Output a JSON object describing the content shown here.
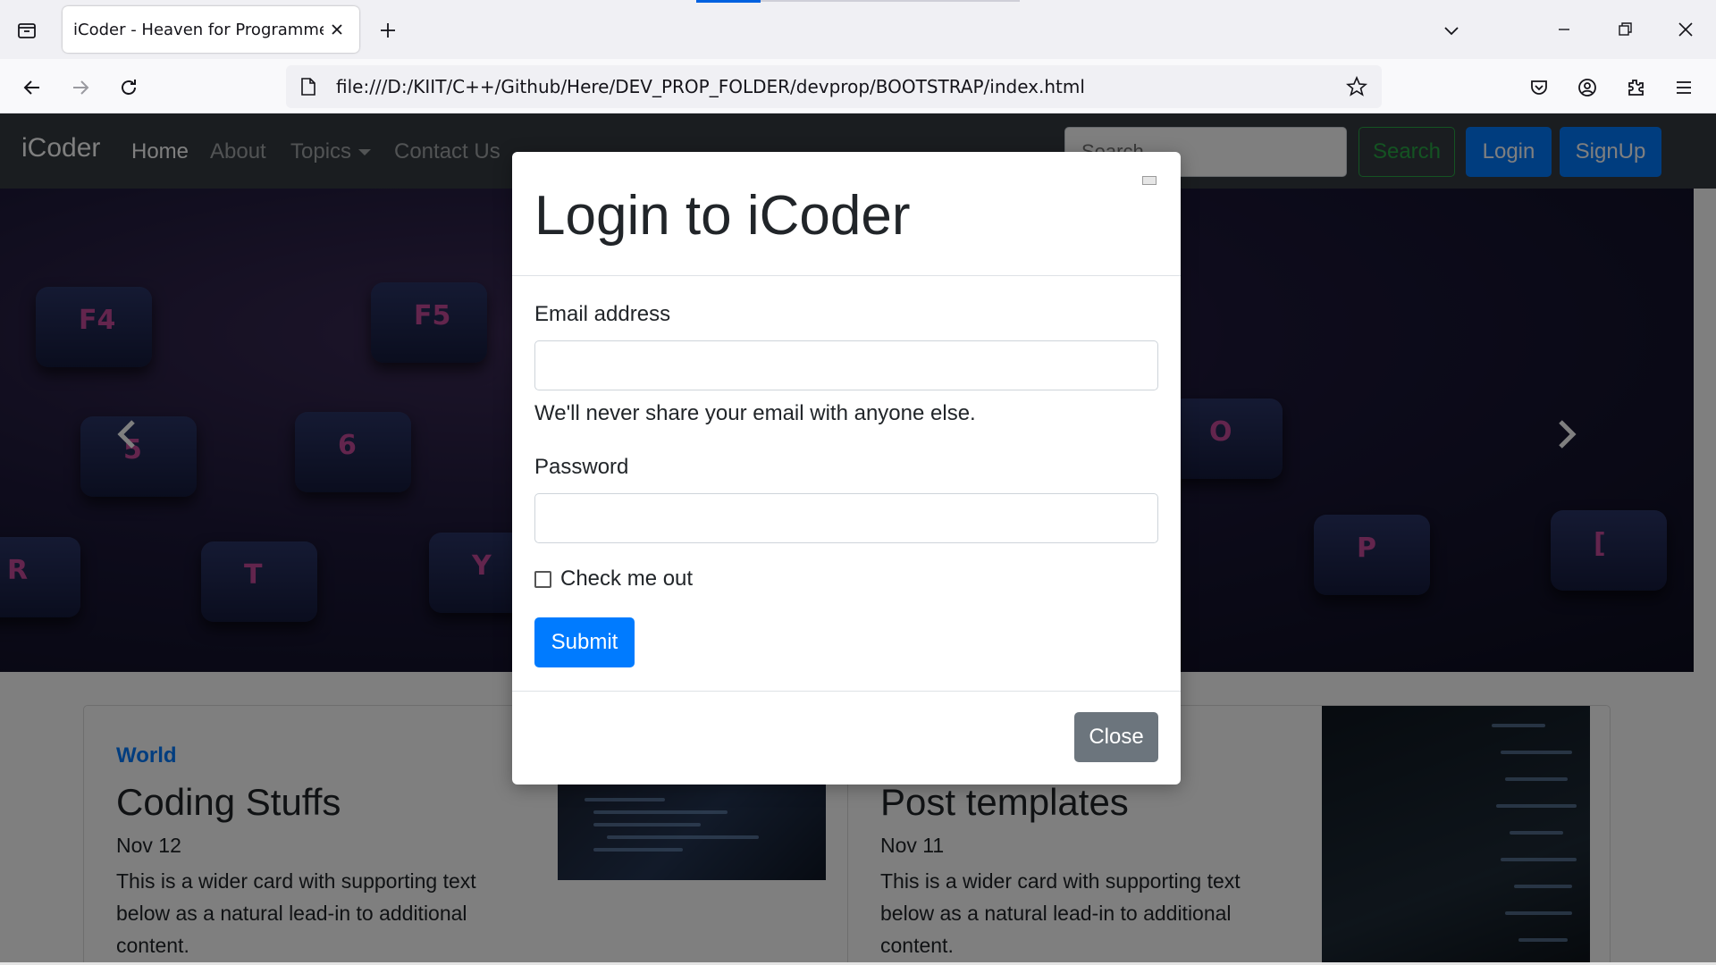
{
  "browser": {
    "tab_title": "iCoder - Heaven for Programmers",
    "url": "file:///D:/KIIT/C++/Github/Here/DEV_PROP_FOLDER/devprop/BOOTSTRAP/index.html",
    "icons": [
      "tab-list-icon",
      "close-icon",
      "plus-icon",
      "chevron-down-icon",
      "minimize-icon",
      "restore-icon",
      "close-window-icon",
      "back-arrow-icon",
      "forward-arrow-icon",
      "reload-icon",
      "page-icon",
      "star-icon",
      "pocket-icon",
      "account-icon",
      "extensions-icon",
      "hamburger-menu-icon"
    ]
  },
  "site": {
    "brand": "iCoder",
    "nav": [
      "Home",
      "About",
      "Topics",
      "Contact Us"
    ],
    "search_placeholder": "Search",
    "search_button": "Search",
    "login_button": "Login",
    "signup_button": "SignUp",
    "carousel_keys": [
      "F4",
      "F5",
      "5",
      "6",
      "R",
      "T",
      "Y",
      "O",
      "P",
      "["
    ]
  },
  "modal": {
    "title": "Login to iCoder",
    "email_label": "Email address",
    "email_value": "",
    "email_help": "We'll never share your email with anyone else.",
    "password_label": "Password",
    "password_value": "",
    "checkbox_label": "Check me out",
    "checkbox_checked": false,
    "submit_label": "Submit",
    "close_label": "Close"
  },
  "cards": [
    {
      "category": "World",
      "title": "Coding Stuffs",
      "date": "Nov 12",
      "text": "This is a wider card with supporting text below as a natural lead-in to additional content."
    },
    {
      "category": "",
      "title": "Post templates",
      "date": "Nov 11",
      "text": "This is a wider card with supporting text below as a natural lead-in to additional content."
    }
  ],
  "colors": {
    "primary": "#007bff",
    "success": "#28a745",
    "secondary": "#6c757d",
    "navbar_dark": "#343a40"
  }
}
